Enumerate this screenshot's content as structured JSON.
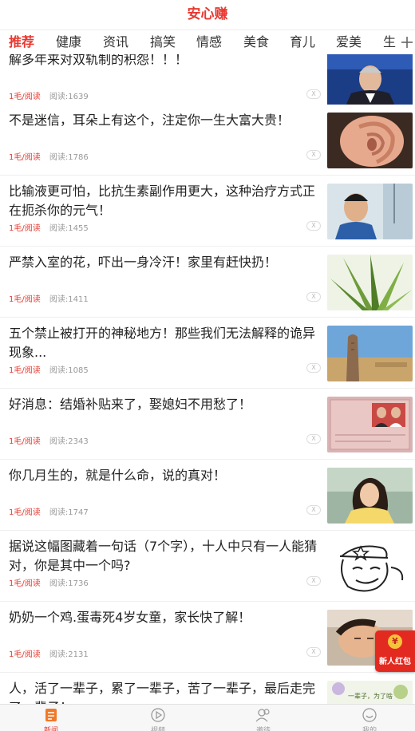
{
  "header": {
    "title": "安心赚"
  },
  "tabs": [
    {
      "label": "推荐",
      "active": true
    },
    {
      "label": "健康"
    },
    {
      "label": "资讯"
    },
    {
      "label": "搞笑"
    },
    {
      "label": "情感"
    },
    {
      "label": "美食"
    },
    {
      "label": "育儿"
    },
    {
      "label": "爱美"
    },
    {
      "label": "生"
    }
  ],
  "feed": [
    {
      "headline": "解多年来对双轨制的积怨！！！",
      "reward": "1毛/阅读",
      "reads": "阅读:1639",
      "thumb": "news-anchor"
    },
    {
      "headline": "不是迷信，耳朵上有这个，注定你一生大富大贵！",
      "reward": "1毛/阅读",
      "reads": "阅读:1786",
      "thumb": "ear"
    },
    {
      "headline": "比输液更可怕，比抗生素副作用更大，这种治疗方式正在扼杀你的元气！",
      "reward": "1毛/阅读",
      "reads": "阅读:1455",
      "thumb": "boy"
    },
    {
      "headline": "严禁入室的花，吓出一身冷汗！家里有赶快扔！",
      "reward": "1毛/阅读",
      "reads": "阅读:1411",
      "thumb": "plant"
    },
    {
      "headline": "五个禁止被打开的神秘地方！那些我们无法解释的诡异现象...",
      "reward": "1毛/阅读",
      "reads": "阅读:1085",
      "thumb": "desert"
    },
    {
      "headline": "好消息：结婚补贴来了，娶媳妇不用愁了！",
      "reward": "1毛/阅读",
      "reads": "阅读:2343",
      "thumb": "certificate"
    },
    {
      "headline": "你几月生的，就是什么命，说的真对！",
      "reward": "1毛/阅读",
      "reads": "阅读:1747",
      "thumb": "woman"
    },
    {
      "headline": "据说这幅图藏着一句话（7个字），十人中只有一人能猜对，你是其中一个吗?",
      "reward": "1毛/阅读",
      "reads": "阅读:1736",
      "thumb": "sketch"
    },
    {
      "headline": "奶奶一个鸡.蛋毒死4岁女童，家长快了解！",
      "reward": "1毛/阅读",
      "reads": "阅读:2131",
      "thumb": "child"
    },
    {
      "headline": "人，活了一辈子，累了一辈子，苦了一辈子，最后走完了一辈子！",
      "reward": "",
      "reads": "",
      "thumb": "flowers",
      "thumb_text": "一辈子，为了啥 有人说，是为了钱"
    }
  ],
  "close_glyph": "X",
  "redpack": {
    "coin": "¥",
    "label": "新人红包"
  },
  "tabbar": [
    {
      "label": "新闻",
      "icon": "news-icon",
      "active": true
    },
    {
      "label": "视频",
      "icon": "video-icon"
    },
    {
      "label": "邀徒",
      "icon": "invite-icon"
    },
    {
      "label": "我的",
      "icon": "profile-icon"
    }
  ],
  "colors": {
    "accent": "#e8382f",
    "meta": "#999999"
  }
}
